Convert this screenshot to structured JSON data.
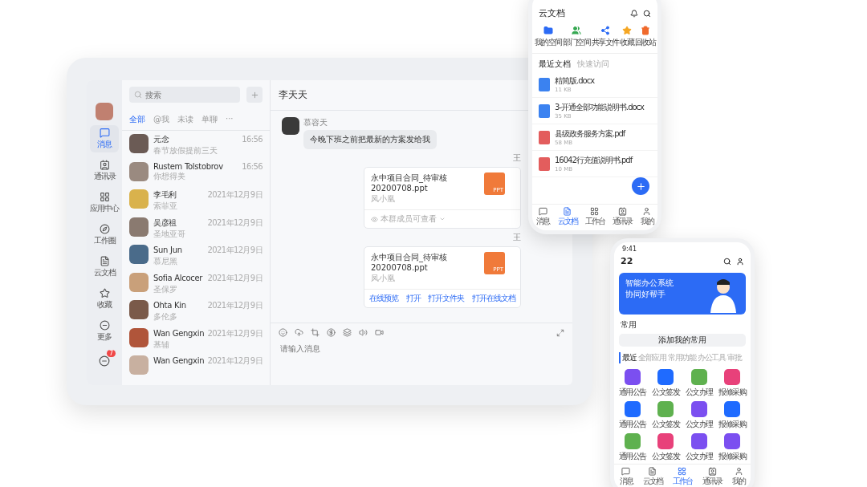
{
  "tablet": {
    "sidebar": {
      "items": [
        {
          "label": "消息",
          "selected": true
        },
        {
          "label": "通讯录",
          "selected": false
        },
        {
          "label": "应用中心",
          "selected": false
        },
        {
          "label": "工作圈",
          "selected": false
        },
        {
          "label": "云文档",
          "selected": false
        },
        {
          "label": "收藏",
          "selected": false
        },
        {
          "label": "更多",
          "selected": false
        }
      ],
      "badge": "7"
    },
    "search": {
      "placeholder": "搜索"
    },
    "filter_tabs": [
      {
        "label": "全部",
        "selected": true
      },
      {
        "label": "@我",
        "selected": false
      },
      {
        "label": "未读",
        "selected": false
      },
      {
        "label": "单聊",
        "selected": false
      },
      {
        "label": "···",
        "selected": false
      }
    ],
    "conversations": [
      {
        "name": "元念",
        "preview": "春节放假提前三天",
        "time": "16:56"
      },
      {
        "name": "Rustem Tolstobrov",
        "preview": "你想得美",
        "time": "16:56"
      },
      {
        "name": "李毛利",
        "preview": "索菲亚",
        "time": "2021年12月9日"
      },
      {
        "name": "吴彦祖",
        "preview": "圣地亚哥",
        "time": "2021年12月9日"
      },
      {
        "name": "Sun Jun",
        "preview": "慕尼黑",
        "time": "2021年12月9日"
      },
      {
        "name": "Sofia Alcocer",
        "preview": "圣保罗",
        "time": "2021年12月9日"
      },
      {
        "name": "Ohta Kin",
        "preview": "多伦多",
        "time": "2021年12月9日"
      },
      {
        "name": "Wan Gengxin",
        "preview": "基辅",
        "time": "2021年12月9日"
      },
      {
        "name": "Wan Gengxin",
        "time": "2021年12月9日"
      }
    ],
    "chat": {
      "title": "李天天",
      "messages": [
        {
          "kind": "text",
          "sender": "慕容天",
          "text": "今晚下班之前把最新的方案发给我"
        },
        {
          "kind": "file",
          "sender": "王",
          "file_name": "永中项目合同_待审核 20200708.ppt",
          "owner": "凤小凰",
          "file_type": "PPT",
          "footer": "本群成员可查看"
        },
        {
          "kind": "file",
          "sender": "王",
          "file_name": "永中项目合同_待审核 20200708.ppt",
          "owner": "凤小凰",
          "file_type": "PPT",
          "actions": [
            "在线预览",
            "打开",
            "打开文件夹",
            "打开在线文档"
          ]
        }
      ],
      "input": {
        "placeholder": "请输入消息"
      }
    }
  },
  "phone_docs": {
    "title": "云文档",
    "quick": [
      "我的空间",
      "部门空间",
      "共享文件",
      "收藏",
      "回收站"
    ],
    "section_tabs": [
      {
        "label": "最近文档",
        "selected": true
      },
      {
        "label": "快速访问",
        "selected": false
      }
    ],
    "files": [
      {
        "kind": "docx",
        "name": "精简版.docx",
        "size": "11 KB"
      },
      {
        "kind": "docx",
        "name": "3-开通全部功能说明书.docx",
        "size": "35 KB"
      },
      {
        "kind": "pdf",
        "name": "县级政务服务方案.pdf",
        "size": "58 MB"
      },
      {
        "kind": "pdf",
        "name": "16042行充值说明书.pdf",
        "size": "10 MB"
      }
    ],
    "nav": [
      {
        "label": "消息",
        "selected": false
      },
      {
        "label": "云文档",
        "selected": true
      },
      {
        "label": "工作台",
        "selected": false
      },
      {
        "label": "通讯录",
        "selected": false
      },
      {
        "label": "我的",
        "selected": false
      }
    ]
  },
  "phone_workbench": {
    "status_time": "9:41",
    "day": "22",
    "banner": [
      "智能办公系统",
      "协同好帮手"
    ],
    "section": "常用",
    "add_button": "添加我的常用",
    "tabs": [
      {
        "label": "最近",
        "selected": true
      },
      {
        "label": "全部应用",
        "selected": false
      },
      {
        "label": "常用功能",
        "selected": false
      },
      {
        "label": "办公工具",
        "selected": false
      },
      {
        "label": "审批",
        "selected": false
      }
    ],
    "apps": [
      {
        "label": "通用公告",
        "color": "#7b4ff0"
      },
      {
        "label": "公文签发",
        "color": "#1f6bff"
      },
      {
        "label": "公文办理",
        "color": "#5fb14f"
      },
      {
        "label": "报修采购",
        "color": "#e8417a"
      },
      {
        "label": "通用公告",
        "color": "#1f6bff"
      },
      {
        "label": "公文签发",
        "color": "#5fb14f"
      },
      {
        "label": "公文办理",
        "color": "#7b4ff0"
      },
      {
        "label": "报修采购",
        "color": "#1f6bff"
      },
      {
        "label": "通用公告",
        "color": "#5fb14f"
      },
      {
        "label": "公文签发",
        "color": "#e8417a"
      },
      {
        "label": "公文办理",
        "color": "#7b4ff0"
      },
      {
        "label": "报修采购",
        "color": "#7b4ff0"
      }
    ],
    "nav": [
      {
        "label": "消息",
        "selected": false
      },
      {
        "label": "云文档",
        "selected": false
      },
      {
        "label": "工作台",
        "selected": true
      },
      {
        "label": "通讯录",
        "selected": false
      },
      {
        "label": "我的",
        "selected": false
      }
    ]
  }
}
